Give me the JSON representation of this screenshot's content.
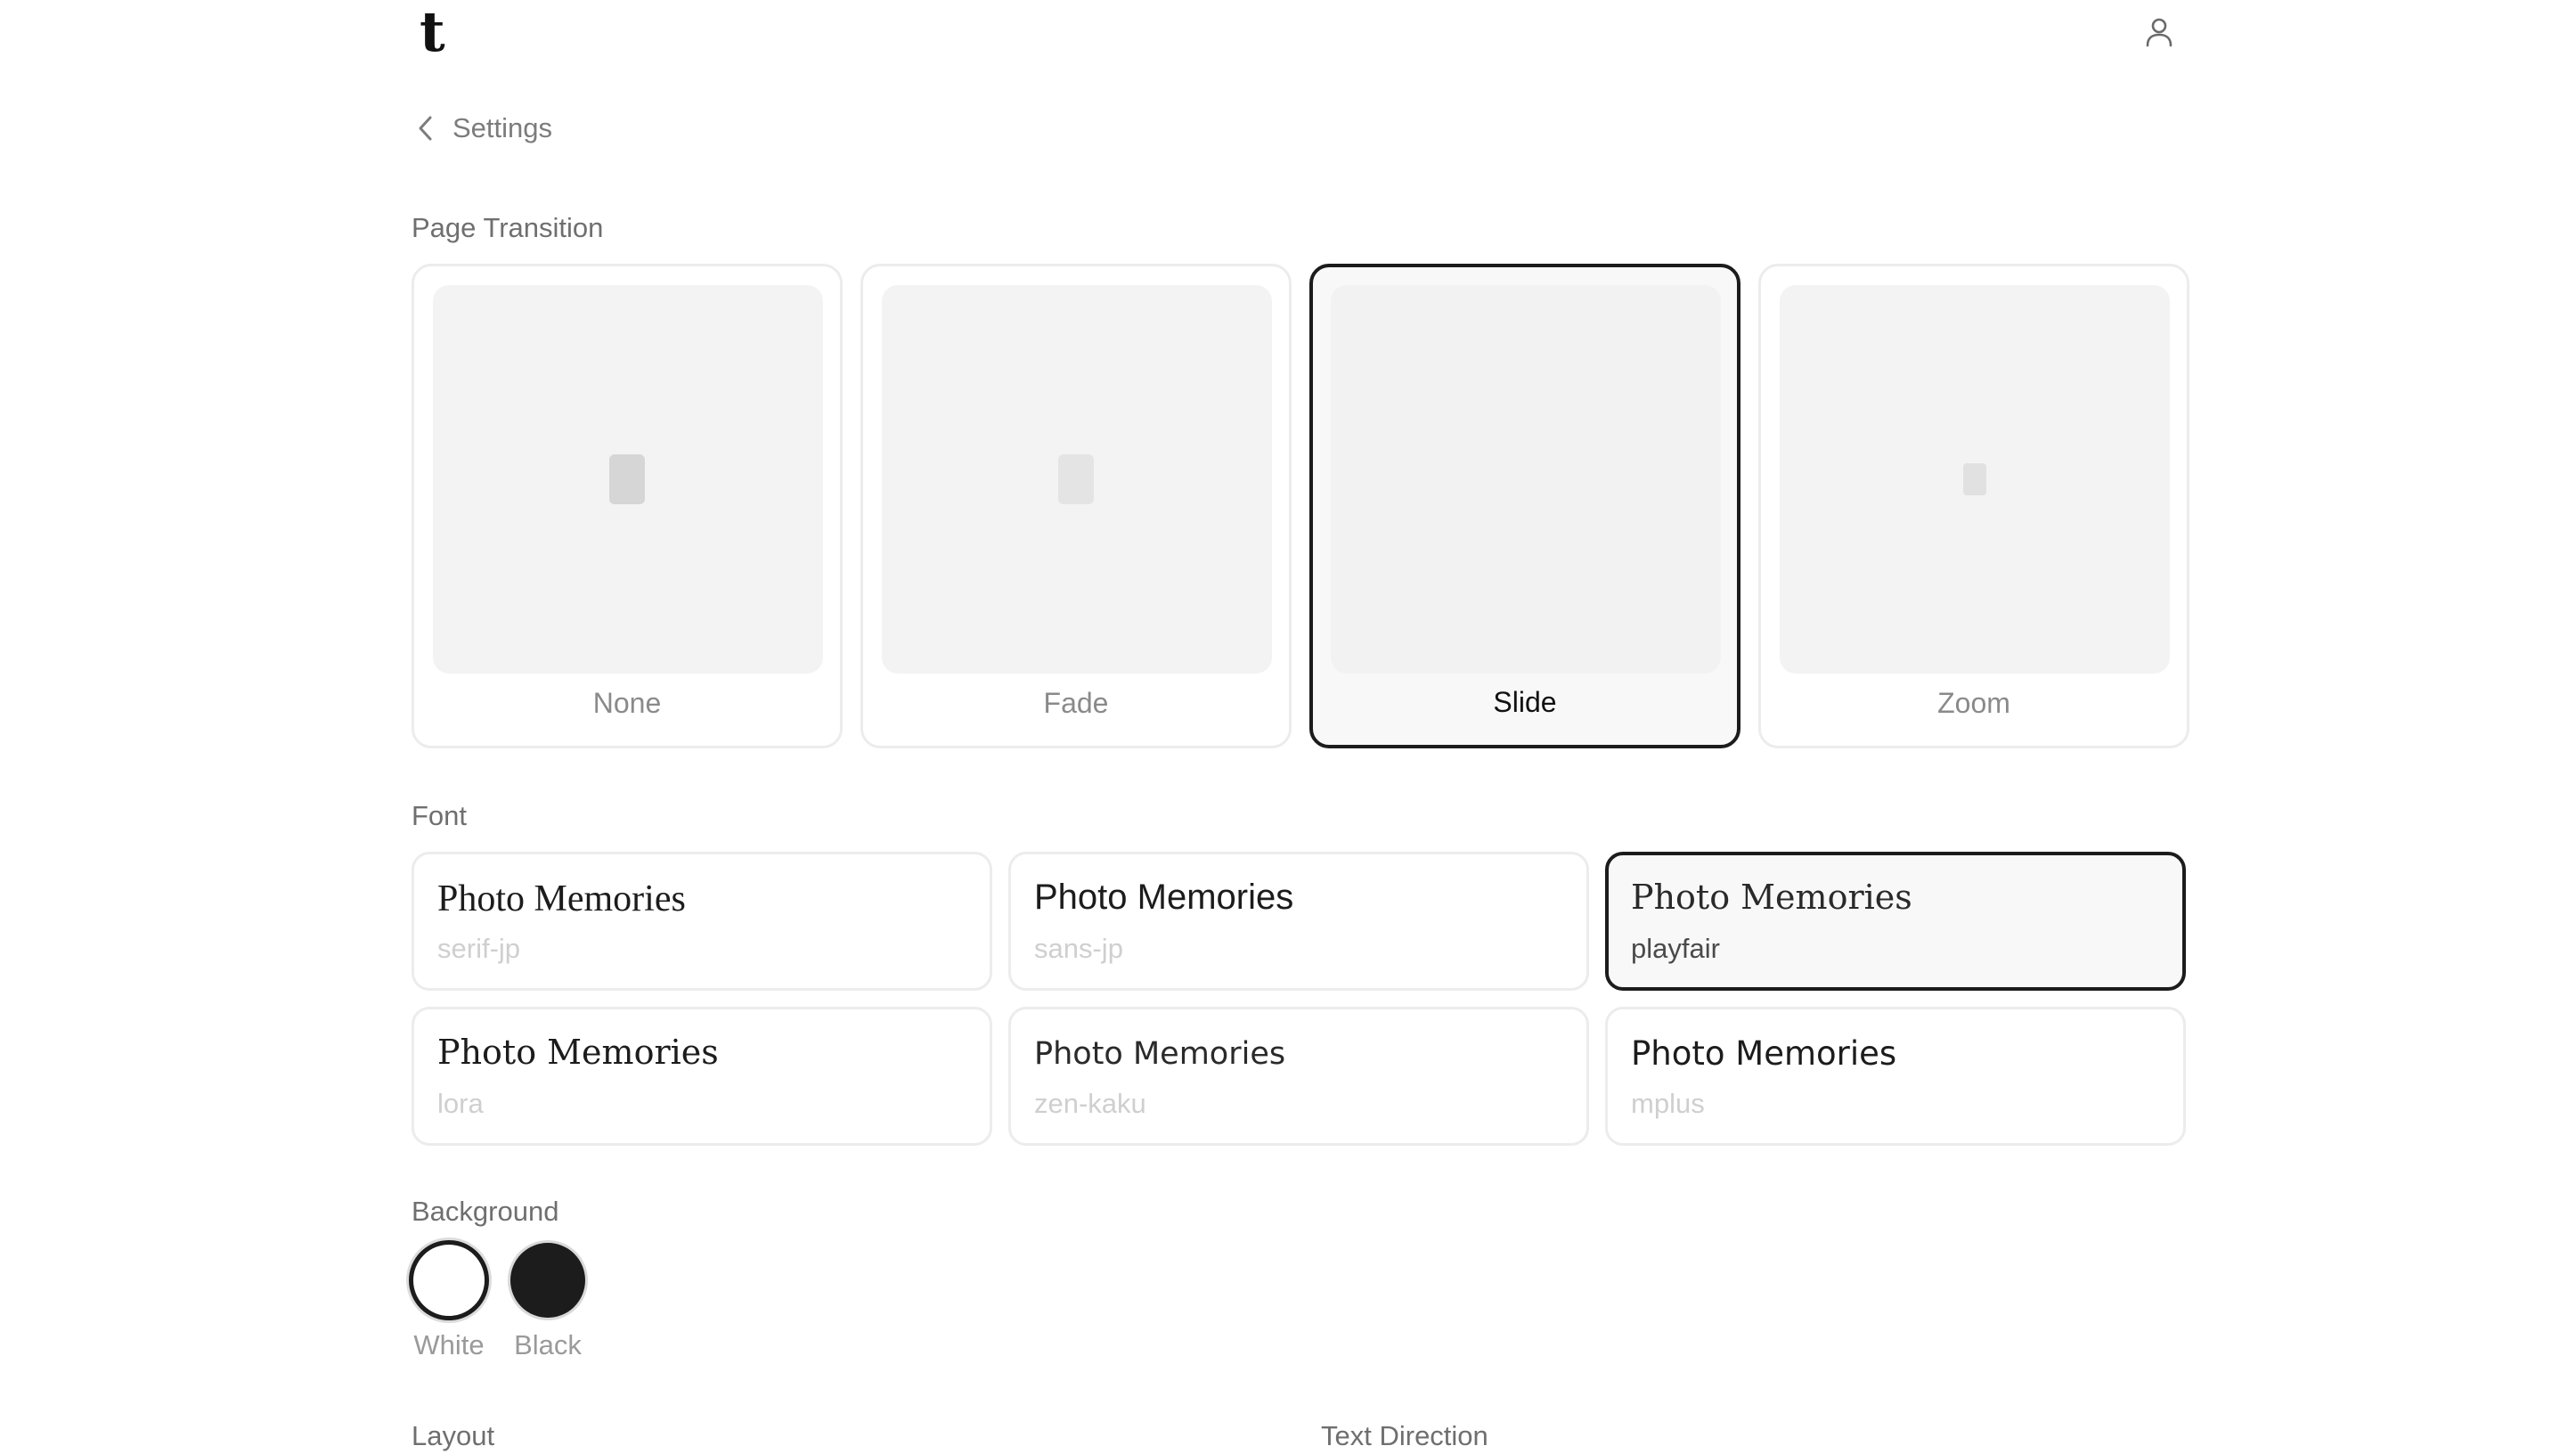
{
  "header": {
    "logo": "t",
    "user_icon": "user-icon"
  },
  "nav": {
    "back_label": "Settings",
    "back_icon": "chevron-left-icon"
  },
  "page_transition": {
    "label": "Page Transition",
    "selected": "Slide",
    "options": [
      {
        "label": "None"
      },
      {
        "label": "Fade"
      },
      {
        "label": "Slide"
      },
      {
        "label": "Zoom"
      }
    ]
  },
  "font": {
    "label": "Font",
    "selected": "playfair",
    "options": [
      {
        "sample": "Photo Memories",
        "name": "serif-jp"
      },
      {
        "sample": "Photo Memories",
        "name": "sans-jp"
      },
      {
        "sample": "Photo Memories",
        "name": "playfair"
      },
      {
        "sample": "Photo Memories",
        "name": "lora"
      },
      {
        "sample": "Photo Memories",
        "name": "zen-kaku"
      },
      {
        "sample": "Photo Memories",
        "name": "mplus"
      }
    ]
  },
  "background": {
    "label": "Background",
    "selected": "White",
    "options": [
      {
        "label": "White",
        "color": "#ffffff"
      },
      {
        "label": "Black",
        "color": "#1c1c1c"
      }
    ]
  },
  "layout": {
    "label": "Layout"
  },
  "text_direction": {
    "label": "Text Direction"
  },
  "colors": {
    "selected_border": "#1c1c1c",
    "card_border": "#ececec",
    "preview_bg": "#f3f3f3",
    "muted_text": "#8a8a8a"
  }
}
